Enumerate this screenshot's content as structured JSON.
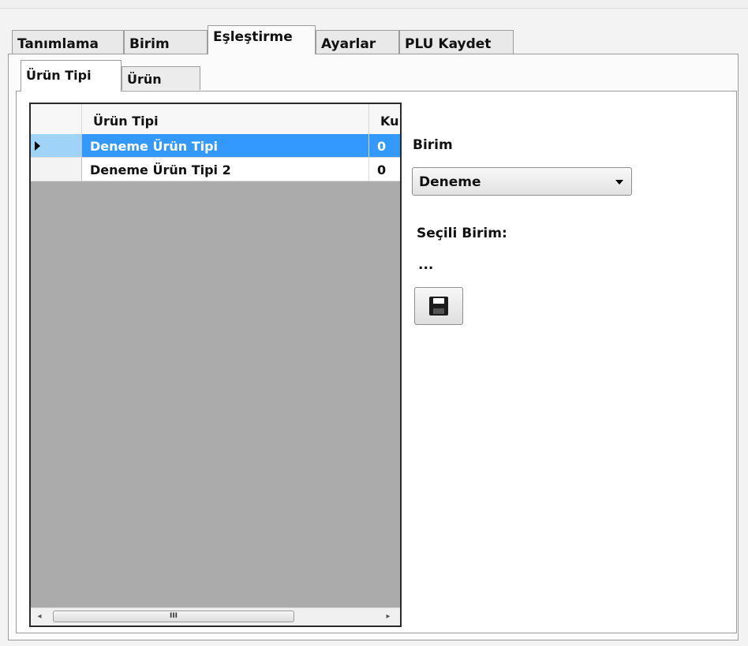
{
  "tabs": [
    "Tanımlama",
    "Birim",
    "Eşleştirme",
    "Ayarlar",
    "PLU Kaydet"
  ],
  "active_tab": "Eşleştirme",
  "sub_tabs": [
    "Ürün Tipi",
    "Ürün"
  ],
  "active_sub_tab": "Ürün Tipi",
  "grid": {
    "columns": [
      "Ürün Tipi",
      "Ku"
    ],
    "rows": [
      {
        "name": "Deneme Ürün Tipi",
        "value": "0",
        "selected": true
      },
      {
        "name": "Deneme Ürün Tipi 2",
        "value": "0",
        "selected": false
      }
    ],
    "scroll_thumb_label": "III",
    "scroll_left": "◂",
    "scroll_right": "▸"
  },
  "form": {
    "birim_label": "Birim",
    "birim_value": "Deneme",
    "secili_label": "Seçili Birim:",
    "secili_value": "...",
    "save_icon": "floppy-disk-icon"
  },
  "colors": {
    "selection": "#3399ff",
    "grid_background": "#ababab"
  }
}
